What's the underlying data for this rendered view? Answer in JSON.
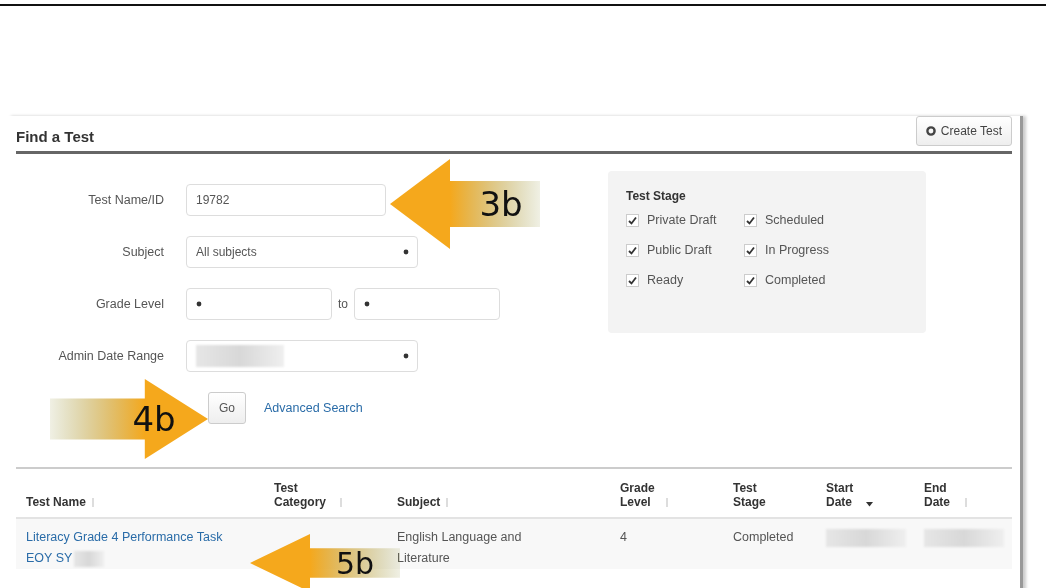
{
  "panel": {
    "title": "Find a Test",
    "create_button": "Create Test"
  },
  "form": {
    "test_name": {
      "label": "Test Name/ID",
      "value": "19782"
    },
    "subject": {
      "label": "Subject",
      "value": "All subjects"
    },
    "grade_level": {
      "label": "Grade Level",
      "joiner": "to"
    },
    "admin_date_range": {
      "label": "Admin Date Range",
      "redacted": true
    },
    "go_button": "Go",
    "advanced_link": "Advanced Search"
  },
  "test_stage": {
    "title": "Test Stage",
    "options": [
      {
        "label": "Private Draft",
        "checked": true
      },
      {
        "label": "Scheduled",
        "checked": true
      },
      {
        "label": "Public Draft",
        "checked": true
      },
      {
        "label": "In Progress",
        "checked": true
      },
      {
        "label": "Ready",
        "checked": true
      },
      {
        "label": "Completed",
        "checked": true
      }
    ]
  },
  "table": {
    "columns": [
      {
        "label": "Test Name",
        "kind": "sortable"
      },
      {
        "label": "Test Category",
        "kind": "sortable"
      },
      {
        "label": "Subject",
        "kind": "sortable"
      },
      {
        "label": "Grade Level",
        "kind": "sortable"
      },
      {
        "label": "Test Stage",
        "kind": "plain"
      },
      {
        "label": "Start Date",
        "kind": "sorted"
      },
      {
        "label": "End Date",
        "kind": "sortable"
      }
    ],
    "rows": [
      {
        "cells": [
          {
            "kind": "link",
            "text": "Literacy Grade 4 Performance Task EOY SY",
            "redacted": true
          },
          {
            "kind": "empty"
          },
          {
            "kind": "text",
            "text": "English Language and Literature"
          },
          {
            "kind": "text",
            "text": "4"
          },
          {
            "kind": "text",
            "text": "Completed"
          },
          {
            "kind": "blur"
          },
          {
            "kind": "blur"
          }
        ]
      }
    ]
  },
  "callouts": [
    {
      "label": "3b",
      "kind": "left"
    },
    {
      "label": "4b",
      "kind": "right"
    },
    {
      "label": "5b",
      "kind": "left"
    }
  ]
}
